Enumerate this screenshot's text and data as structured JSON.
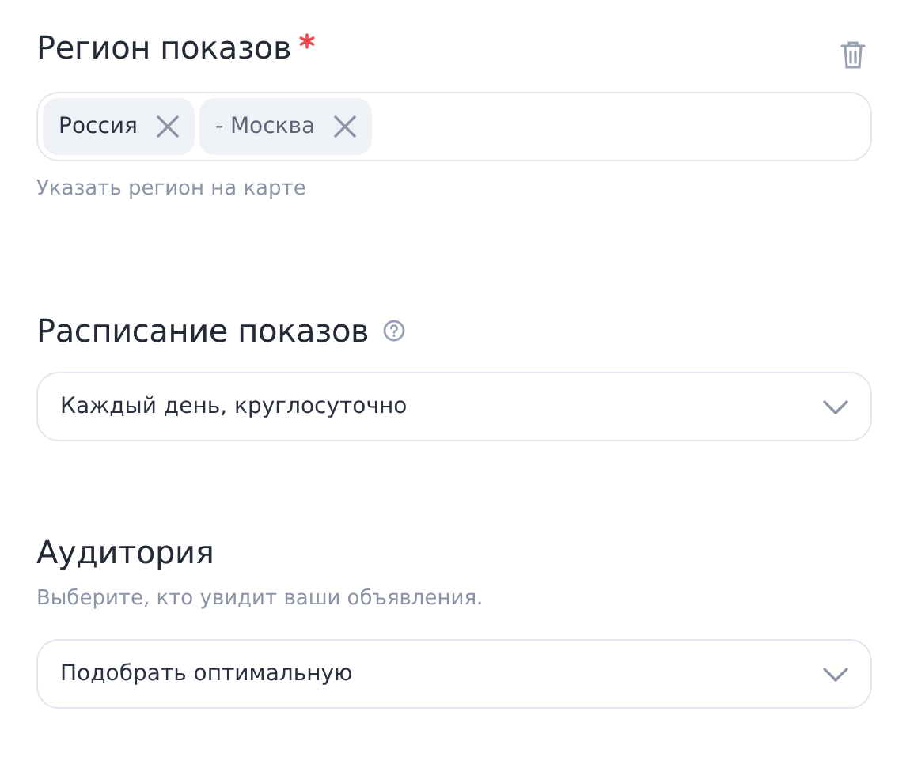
{
  "sections": [
    {
      "kind": "region",
      "title": "Регион показов",
      "required": true,
      "deletable": true,
      "chips": [
        {
          "label": "Россия",
          "kind": "country"
        },
        {
          "label": "- Москва",
          "kind": "city"
        }
      ],
      "link": "Указать регион на карте"
    },
    {
      "kind": "select",
      "title": "Расписание показов",
      "help": true,
      "value": "Каждый день, круглосуточно"
    },
    {
      "kind": "select",
      "title": "Аудитория",
      "hint": "Выберите, кто увидит ваши объявления.",
      "value": "Подобрать оптимальную"
    }
  ]
}
